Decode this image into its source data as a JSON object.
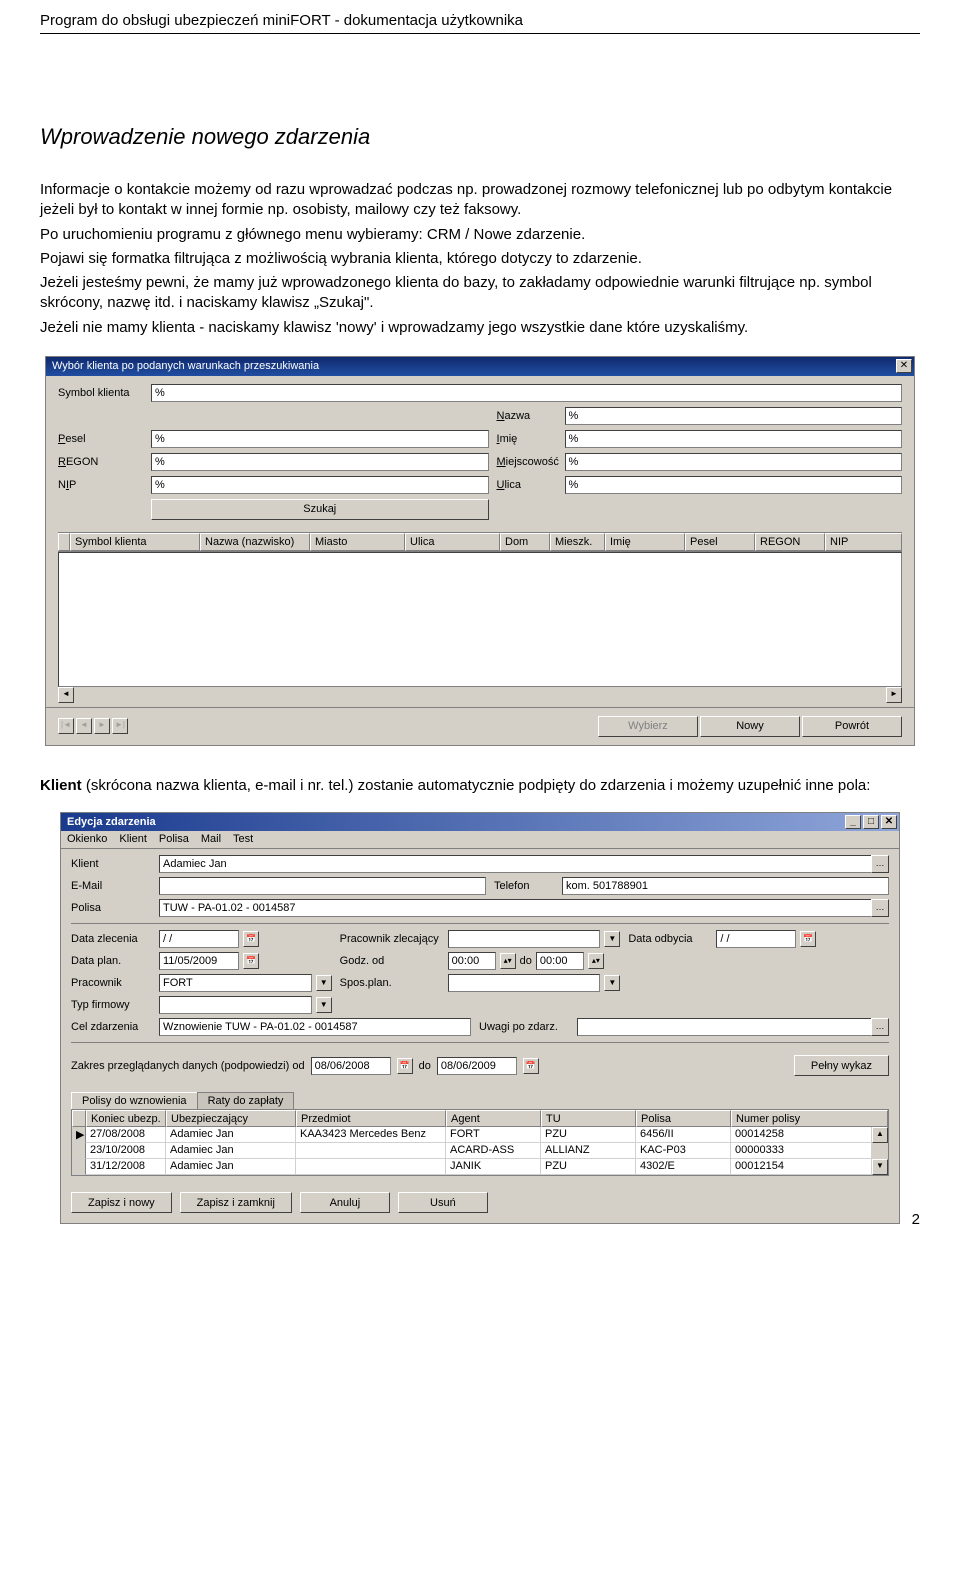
{
  "header": "Program do obsługi ubezpieczeń miniFORT - dokumentacja użytkownika",
  "section_title": "Wprowadzenie nowego zdarzenia",
  "para1": "Informacje o kontakcie możemy od razu wprowadzać podczas np. prowadzonej rozmowy telefonicznej lub po odbytym kontakcie jeżeli był to kontakt w innej formie np. osobisty, mailowy czy też faksowy.",
  "para2": "Po uruchomieniu programu z głównego menu wybieramy: CRM / Nowe zdarzenie.",
  "para3": "Pojawi się formatka filtrująca z możliwością wybrania klienta, którego dotyczy to zdarzenie.",
  "para4": "Jeżeli jesteśmy pewni, że mamy już wprowadzonego klienta do bazy, to zakładamy odpowiednie warunki filtrujące np. symbol skrócony, nazwę itd. i naciskamy klawisz „Szukaj\".",
  "para5": "Jeżeli nie mamy klienta - naciskamy klawisz 'nowy' i wprowadzamy jego wszystkie dane które uzyskaliśmy.",
  "para_after": "Klient (skrócona nazwa klienta, e-mail i nr. tel.) zostanie automatycznie podpięty do zdarzenia i możemy uzupełnić inne pola:",
  "page_number": "2",
  "d1": {
    "title": "Wybór klienta po podanych warunkach przeszukiwania",
    "labels": {
      "symbol": "Symbol klienta",
      "nazwa": "Nazwa",
      "pesel": "Pesel",
      "imie": "Imię",
      "regon": "REGON",
      "miejsc": "Miejscowość",
      "nip": "NIP",
      "ulica": "Ulica"
    },
    "percent": "%",
    "szukaj": "Szukaj",
    "cols": [
      "Symbol klienta",
      "Nazwa (nazwisko)",
      "Miasto",
      "Ulica",
      "Dom",
      "Mieszk.",
      "Imię",
      "Pesel",
      "REGON",
      "NIP"
    ],
    "btns": {
      "wybierz": "Wybierz",
      "nowy": "Nowy",
      "powrot": "Powrót"
    }
  },
  "d2": {
    "title": "Edycja zdarzenia",
    "menu": [
      "Okienko",
      "Klient",
      "Polisa",
      "Mail",
      "Test"
    ],
    "labels": {
      "klient": "Klient",
      "email": "E-Mail",
      "telefon": "Telefon",
      "polisa": "Polisa",
      "data_zlec": "Data zlecenia",
      "prac_zlec": "Pracownik zlecający",
      "data_odb": "Data odbycia",
      "data_plan": "Data plan.",
      "godz_od": "Godz. od",
      "do": "do",
      "pracownik": "Pracownik",
      "spos": "Spos.plan.",
      "typ": "Typ firmowy",
      "cel": "Cel zdarzenia",
      "uwagi": "Uwagi po zdarz.",
      "zakres": "Zakres przeglądanych danych (podpowiedzi) od",
      "pelny": "Pełny wykaz"
    },
    "vals": {
      "klient": "Adamiec Jan",
      "telefon": "kom. 501788901",
      "polisa": "TUW - PA-01.02 - 0014587",
      "data_zlec": "/ /",
      "data_plan": "11/05/2009",
      "godz_od": "00:00",
      "godz_do": "00:00",
      "pracownik": "FORT",
      "cel": "Wznowienie TUW - PA-01.02 - 0014587",
      "data_odb": "/ /",
      "range_from": "08/06/2008",
      "range_to": "08/06/2009"
    },
    "tabs": [
      "Polisy do wznowienia",
      "Raty do zapłaty"
    ],
    "cols": [
      "Koniec ubezp.",
      "Ubezpieczający",
      "Przedmiot",
      "Agent",
      "TU",
      "Polisa",
      "Numer polisy"
    ],
    "rows": [
      {
        "k": "27/08/2008",
        "u": "Adamiec Jan",
        "p": "KAA3423 Mercedes Benz",
        "a": "FORT",
        "t": "PZU",
        "po": "6456/II",
        "n": "00014258"
      },
      {
        "k": "23/10/2008",
        "u": "Adamiec Jan",
        "p": "",
        "a": "ACARD-ASS",
        "t": "ALLIANZ",
        "po": "KAC-P03",
        "n": "00000333"
      },
      {
        "k": "31/12/2008",
        "u": "Adamiec Jan",
        "p": "",
        "a": "JANIK",
        "t": "PZU",
        "po": "4302/E",
        "n": "00012154"
      }
    ],
    "btns": {
      "save_new": "Zapisz i nowy",
      "save_close": "Zapisz i zamknij",
      "anuluj": "Anuluj",
      "usun": "Usuń"
    }
  }
}
